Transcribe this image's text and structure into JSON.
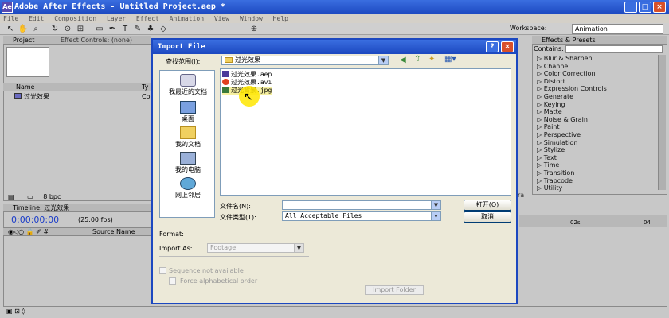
{
  "app": {
    "title": "Adobe After Effects - Untitled Project.aep *",
    "icon_label": "Ae",
    "menu": [
      "File",
      "Edit",
      "Composition",
      "Layer",
      "Effect",
      "Animation",
      "View",
      "Window",
      "Help"
    ],
    "window_buttons": {
      "minimize": "_",
      "maximize": "□",
      "close": "×"
    }
  },
  "toolbar": {
    "tools": [
      "selection-tool",
      "hand-tool",
      "zoom-tool",
      "rotate-tool",
      "camera-orbit-tool",
      "pan-behind-tool",
      "mask-tool",
      "pen-tool",
      "type-tool",
      "brush-tool",
      "clone-stamp-tool",
      "eraser-tool"
    ],
    "workspace_label": "Workspace:",
    "workspace_value": "Animation"
  },
  "project_panel": {
    "tab": "Project",
    "effect_controls_tab": "Effect Controls: (none)",
    "col_name": "Name",
    "col_type": "Ty",
    "item_name": "过光效果",
    "item_type": "Co",
    "bpc": "8 bpc"
  },
  "effects_panel": {
    "tab": "Effects & Presets",
    "contains_label": "Contains:",
    "categories": [
      "Blur & Sharpen",
      "Channel",
      "Color Correction",
      "Distort",
      "Expression Controls",
      "Generate",
      "Keying",
      "Matte",
      "Noise & Grain",
      "Paint",
      "Perspective",
      "Simulation",
      "Stylize",
      "Text",
      "Time",
      "Transition",
      "Trapcode",
      "Utility"
    ]
  },
  "timeline": {
    "tab": "Timeline: 过光效果",
    "timecode": "0:00:00:00",
    "fps": "(25.00 fps)",
    "source_name": "Source Name",
    "ruler_02": "02s",
    "ruler_04": "04",
    "side_label": "ra"
  },
  "dialog": {
    "title": "Import File",
    "look_in_label": "查找范围(I):",
    "look_in_value": "过光效果",
    "places": [
      "我最近的文档",
      "桌面",
      "我的文档",
      "我的电脑",
      "网上邻居"
    ],
    "files": [
      {
        "name": "过光效果.aep",
        "icon": "aep-file-icon",
        "color": "#4a3a9a"
      },
      {
        "name": "过光效果.avi",
        "icon": "avi-file-icon",
        "color": "#e04020"
      },
      {
        "name": "过光背景.jpg",
        "icon": "jpg-file-icon",
        "color": "#3a7a3a"
      }
    ],
    "filename_label": "文件名(N):",
    "filename_value": "",
    "filetype_label": "文件类型(T):",
    "filetype_value": "All Acceptable Files",
    "open_label": "打开(O)",
    "cancel_label": "取消",
    "format_label": "Format:",
    "import_as_label": "Import As:",
    "import_as_value": "Footage",
    "sequence_label": "Sequence not available",
    "force_alpha_label": "Force alphabetical order",
    "import_folder_label": "Import Folder",
    "help_label": "?",
    "close_label": "×"
  }
}
